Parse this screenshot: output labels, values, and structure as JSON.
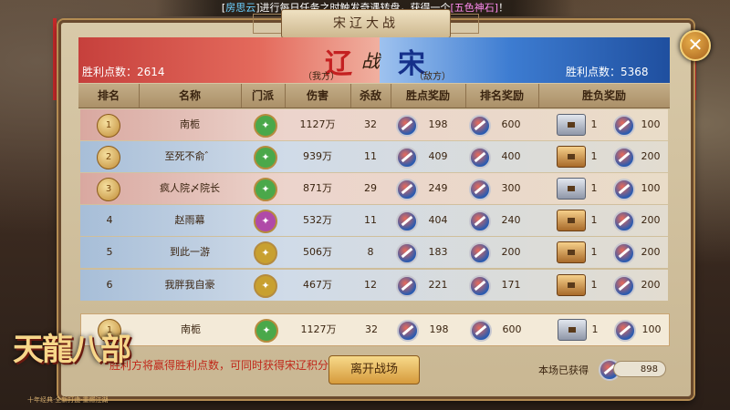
{
  "notice": {
    "prefix": "[",
    "name": "房思云",
    "mid": "]进行每日任务之时触发奇遇转盘，获得一个",
    "item": "[五色神石]",
    "suffix": "！"
  },
  "title": "宋辽大战",
  "close_label": "✕",
  "banner": {
    "left_points_label": "胜利点数：2614",
    "left_side": "（我方）",
    "right_points_label": "胜利点数：5368",
    "right_side": "（敌方）",
    "vs_left": "辽",
    "vs_mid": "战",
    "vs_right": "宋"
  },
  "headers": [
    "排名",
    "名称",
    "门派",
    "伤害",
    "杀敌",
    "胜点奖励",
    "排名奖励",
    "胜负奖励"
  ],
  "rows": [
    {
      "rank": "1",
      "name": "南栀",
      "damage": "1127万",
      "kills": "32",
      "win_pts": "198",
      "rank_reward": "600",
      "chest_count": "1",
      "result": "100",
      "side": "red",
      "sect_color": "#4aa84a",
      "chest": "silver"
    },
    {
      "rank": "2",
      "name": "至死不俞゛",
      "damage": "939万",
      "kills": "11",
      "win_pts": "409",
      "rank_reward": "400",
      "chest_count": "1",
      "result": "200",
      "side": "blue",
      "sect_color": "#4aa84a",
      "chest": "gold"
    },
    {
      "rank": "3",
      "name": "疯人院〆院长",
      "damage": "871万",
      "kills": "29",
      "win_pts": "249",
      "rank_reward": "300",
      "chest_count": "1",
      "result": "100",
      "side": "red",
      "sect_color": "#4aa84a",
      "chest": "silver"
    },
    {
      "rank": "4",
      "name": "赵雨幕",
      "damage": "532万",
      "kills": "11",
      "win_pts": "404",
      "rank_reward": "240",
      "chest_count": "1",
      "result": "200",
      "side": "blue",
      "sect_color": "#b04aa8",
      "chest": "gold"
    },
    {
      "rank": "5",
      "name": "到此一游",
      "damage": "506万",
      "kills": "8",
      "win_pts": "183",
      "rank_reward": "200",
      "chest_count": "1",
      "result": "200",
      "side": "blue",
      "sect_color": "#c8a030",
      "chest": "gold"
    },
    {
      "rank": "6",
      "name": "我胖我自豪",
      "damage": "467万",
      "kills": "12",
      "win_pts": "221",
      "rank_reward": "171",
      "chest_count": "1",
      "result": "200",
      "side": "blue",
      "sect_color": "#c8a030",
      "chest": "gold"
    }
  ],
  "self_row": {
    "rank": "1",
    "name": "南栀",
    "damage": "1127万",
    "kills": "32",
    "win_pts": "198",
    "rank_reward": "600",
    "chest_count": "1",
    "result": "100"
  },
  "footer": {
    "tip": "胜利方将赢得胜利点数，可同时获得宋辽积分",
    "leave_label": "离开战场",
    "gained_label": "本场已获得",
    "gained_value": "898"
  },
  "logo": {
    "text": "天龍八部",
    "sub": "十年经典·全新打造·重燃江湖"
  }
}
